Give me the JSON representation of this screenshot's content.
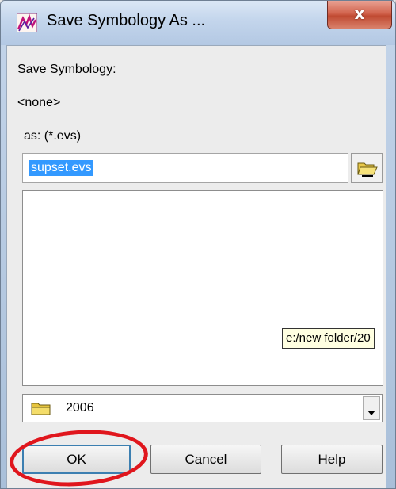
{
  "window": {
    "title": "Save Symbology As ...",
    "close_label": "x"
  },
  "dialog": {
    "save_symbology_label": "Save Symbology:",
    "current_symbology": "<none>",
    "as_label": "as: (*.evs)",
    "filename_value": "supset.evs",
    "tooltip": "e:/new folder/20",
    "folder_value": "2006"
  },
  "buttons": {
    "ok": "OK",
    "cancel": "Cancel",
    "help": "Help"
  },
  "icons": {
    "app": "symbology-app-icon",
    "browse": "open-folder-icon",
    "folder": "folder-icon",
    "dropdown": "chevron-down-icon"
  },
  "colors": {
    "selection": "#3399ff",
    "close_button": "#c9513a",
    "highlight_ring": "#e0161d",
    "tooltip_bg": "#ffffe1"
  }
}
